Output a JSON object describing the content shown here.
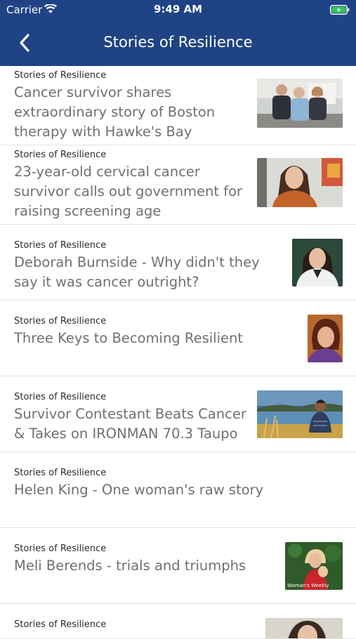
{
  "status_bar": {
    "carrier": "Carrier",
    "time": "9:49 AM"
  },
  "nav": {
    "title": "Stories of Resilience",
    "back_icon": "chevron-left-icon"
  },
  "colors": {
    "header": "#1f4384",
    "title_text": "#707070"
  },
  "articles": [
    {
      "category": "Stories of Resilience",
      "title": "Cancer survivor shares extraordinary story of Boston therapy with Hawke's Bay",
      "thumbnail": "family-photo"
    },
    {
      "category": "Stories of Resilience",
      "title": "23-year-old cervical cancer survivor calls out government for raising screening age",
      "thumbnail": "woman-portrait"
    },
    {
      "category": "Stories of Resilience",
      "title": "Deborah Burnside - Why didn't they say it was cancer outright?",
      "thumbnail": "doctor-portrait"
    },
    {
      "category": "Stories of Resilience",
      "title": "Three Keys to Becoming Resilient",
      "thumbnail": "woman-headshot"
    },
    {
      "category": "Stories of Resilience",
      "title": "Survivor Contestant Beats Cancer & Takes on IRONMAN 70.3 Taupo",
      "thumbnail": "lake-portrait"
    },
    {
      "category": "Stories of Resilience",
      "title": "Helen King - One woman's raw story",
      "thumbnail": ""
    },
    {
      "category": "Stories of Resilience",
      "title": "Meli Berends - trials and triumphs",
      "thumbnail": "magazine-cover",
      "thumbnail_text": "Woman's Weekly"
    },
    {
      "category": "Stories of Resilience",
      "title": "",
      "thumbnail": "partial-portrait"
    }
  ]
}
